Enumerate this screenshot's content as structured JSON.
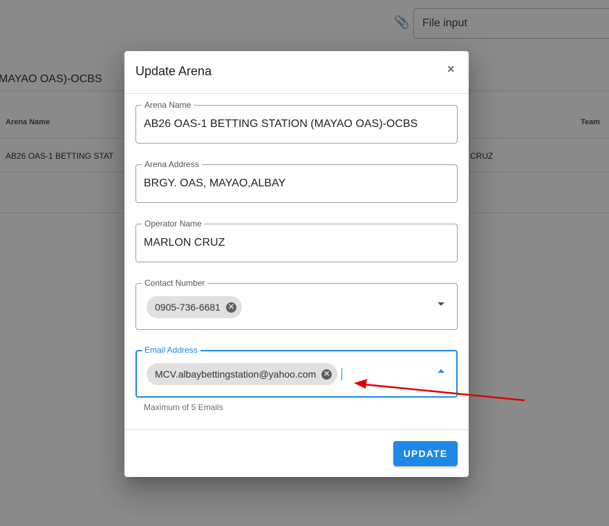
{
  "background": {
    "file_input_placeholder": "File input",
    "subtitle": "MAYAO OAS)-OCBS",
    "table": {
      "col_arena_name": "Arena Name",
      "col_team": "Team",
      "row_arena_name": "AB26 OAS-1 BETTING STAT",
      "row_operator": "CRUZ"
    }
  },
  "dialog": {
    "title": "Update Arena",
    "close_glyph": "×",
    "fields": {
      "arena_name": {
        "label": "Arena Name",
        "value": "AB26 OAS-1 BETTING STATION (MAYAO OAS)-OCBS"
      },
      "arena_address": {
        "label": "Arena Address",
        "value": "BRGY. OAS, MAYAO,ALBAY"
      },
      "operator_name": {
        "label": "Operator Name",
        "value": "MARLON CRUZ"
      },
      "contact_number": {
        "label": "Contact Number",
        "chips": [
          "0905-736-6681"
        ]
      },
      "email_address": {
        "label": "Email Address",
        "chips": [
          "MCV.albaybettingstation@yahoo.com"
        ],
        "hint": "Maximum of 5 Emails"
      }
    },
    "update_button": "UPDATE"
  },
  "colors": {
    "accent": "#1e88e5",
    "annotation_arrow": "#e00000"
  }
}
